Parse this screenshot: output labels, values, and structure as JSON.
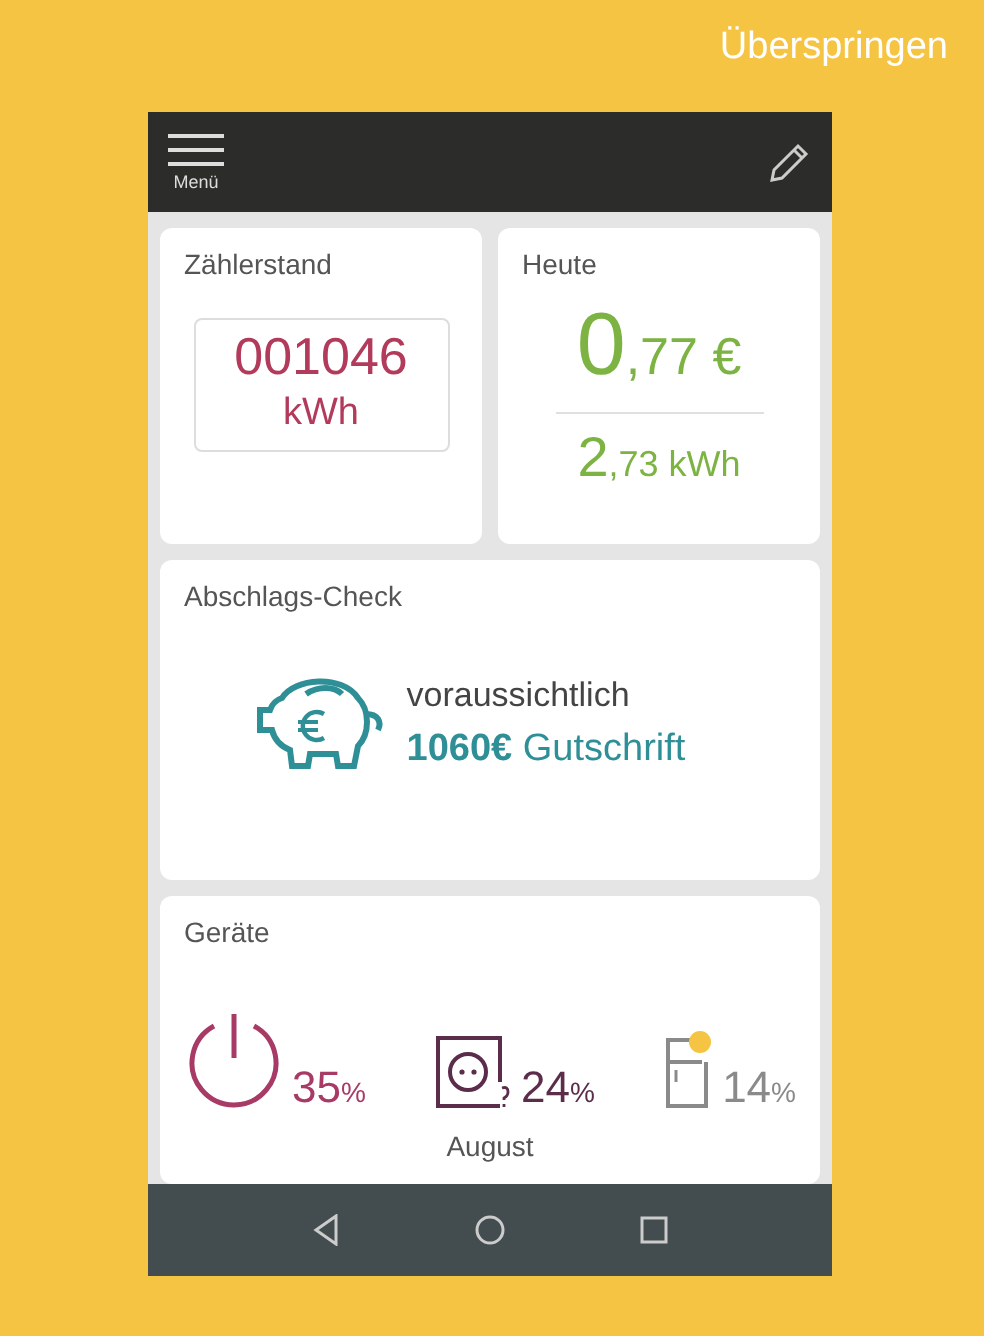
{
  "skip_link": "Überspringen",
  "top_bar": {
    "menu_label": "Menü"
  },
  "meter": {
    "title": "Zählerstand",
    "reading": "001046",
    "unit": "kWh"
  },
  "today": {
    "title": "Heute",
    "cost_main": "0",
    "cost_rest": ",77 €",
    "energy_main": "2",
    "energy_rest": ",73 kWh"
  },
  "payment_check": {
    "title": "Abschlags-Check",
    "line_1": "voraussichtlich",
    "amount": "1060€",
    "line_2_rest": "Gutschrift"
  },
  "devices": {
    "title": "Geräte",
    "items": [
      {
        "kind": "power",
        "value": "35",
        "unit": "%",
        "color": "#a83a66",
        "notified": false
      },
      {
        "kind": "socket",
        "value": "24",
        "unit": "%",
        "color": "#5b2d4b",
        "notified": false
      },
      {
        "kind": "fridge",
        "value": "14",
        "unit": "%",
        "color": "#8a8a8a",
        "notified": true
      }
    ],
    "month": "August"
  }
}
